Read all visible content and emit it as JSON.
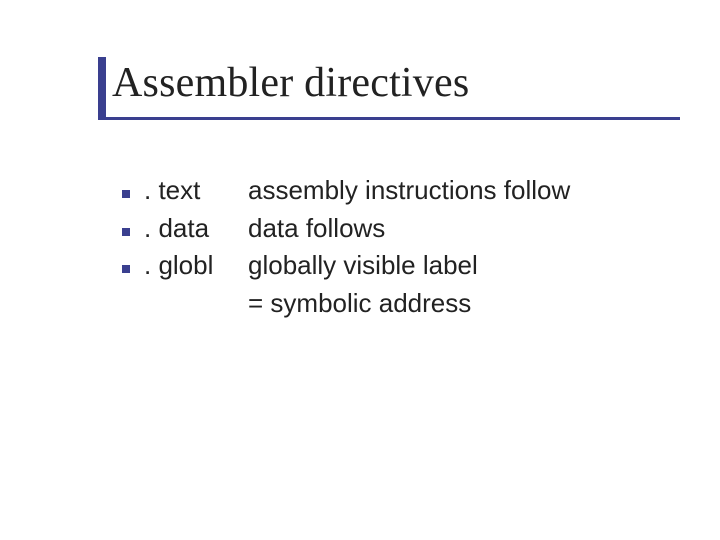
{
  "title": "Assembler directives",
  "accent_color": "#3a3f8f",
  "items": [
    {
      "directive": ". text",
      "desc": "assembly instructions follow"
    },
    {
      "directive": ". data",
      "desc": "data follows"
    },
    {
      "directive": ". globl",
      "desc": "globally visible label"
    }
  ],
  "continuation": "= symbolic address"
}
